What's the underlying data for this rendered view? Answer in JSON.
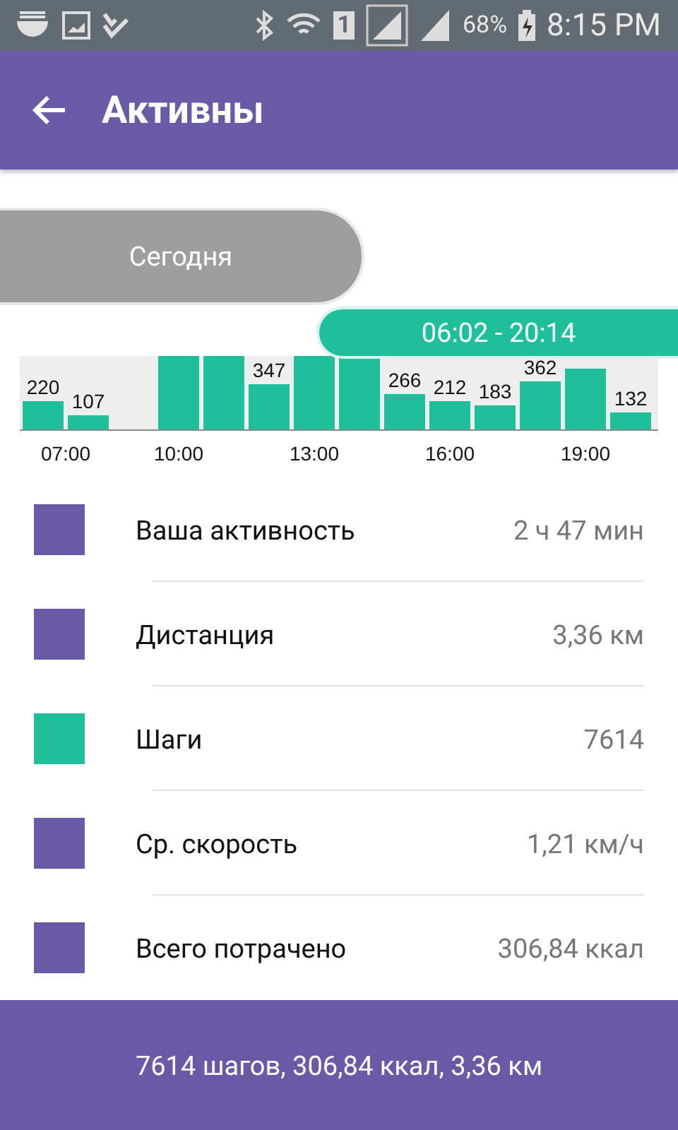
{
  "status_bar": {
    "battery": "68%",
    "time": "8:15 PM",
    "sim": "1"
  },
  "header": {
    "title": "Активны"
  },
  "tabs": [
    {
      "label": "Сегодня",
      "selected": false
    },
    {
      "label": "06:02 - 20:14",
      "selected": true
    }
  ],
  "chart": {
    "bars": [
      {
        "kind": "labeled",
        "label": "220"
      },
      {
        "kind": "labeled",
        "label": "107"
      },
      {
        "kind": "empty"
      },
      {
        "kind": "clipped"
      },
      {
        "kind": "clipped"
      },
      {
        "kind": "labeled",
        "label": "347"
      },
      {
        "kind": "clipped"
      },
      {
        "kind": "clipped"
      },
      {
        "kind": "labeled",
        "label": "266"
      },
      {
        "kind": "labeled",
        "label": "212"
      },
      {
        "kind": "labeled",
        "label": "183"
      },
      {
        "kind": "labeled",
        "label": "362"
      },
      {
        "kind": "clipped"
      },
      {
        "kind": "labeled",
        "label": "132"
      }
    ],
    "time_labels": [
      "07:00",
      "10:00",
      "13:00",
      "16:00",
      "19:00"
    ]
  },
  "metrics": [
    {
      "label": "Ваша активность",
      "value": "2 ч 47 мин",
      "color": "#6a5aa5"
    },
    {
      "label": "Дистанция",
      "value": "3,36 км",
      "color": "#6a5aa5"
    },
    {
      "label": "Шаги",
      "value": "7614",
      "color": "#1fbf9c"
    },
    {
      "label": "Ср. скорость",
      "value": "1,21 км/ч",
      "color": "#6a5aa5"
    },
    {
      "label": "Всего потрачено",
      "value": "306,84 ккал",
      "color": "#6a5aa5"
    }
  ],
  "footer": {
    "summary": "7614 шагов, 306,84 ккал, 3,36 км"
  }
}
